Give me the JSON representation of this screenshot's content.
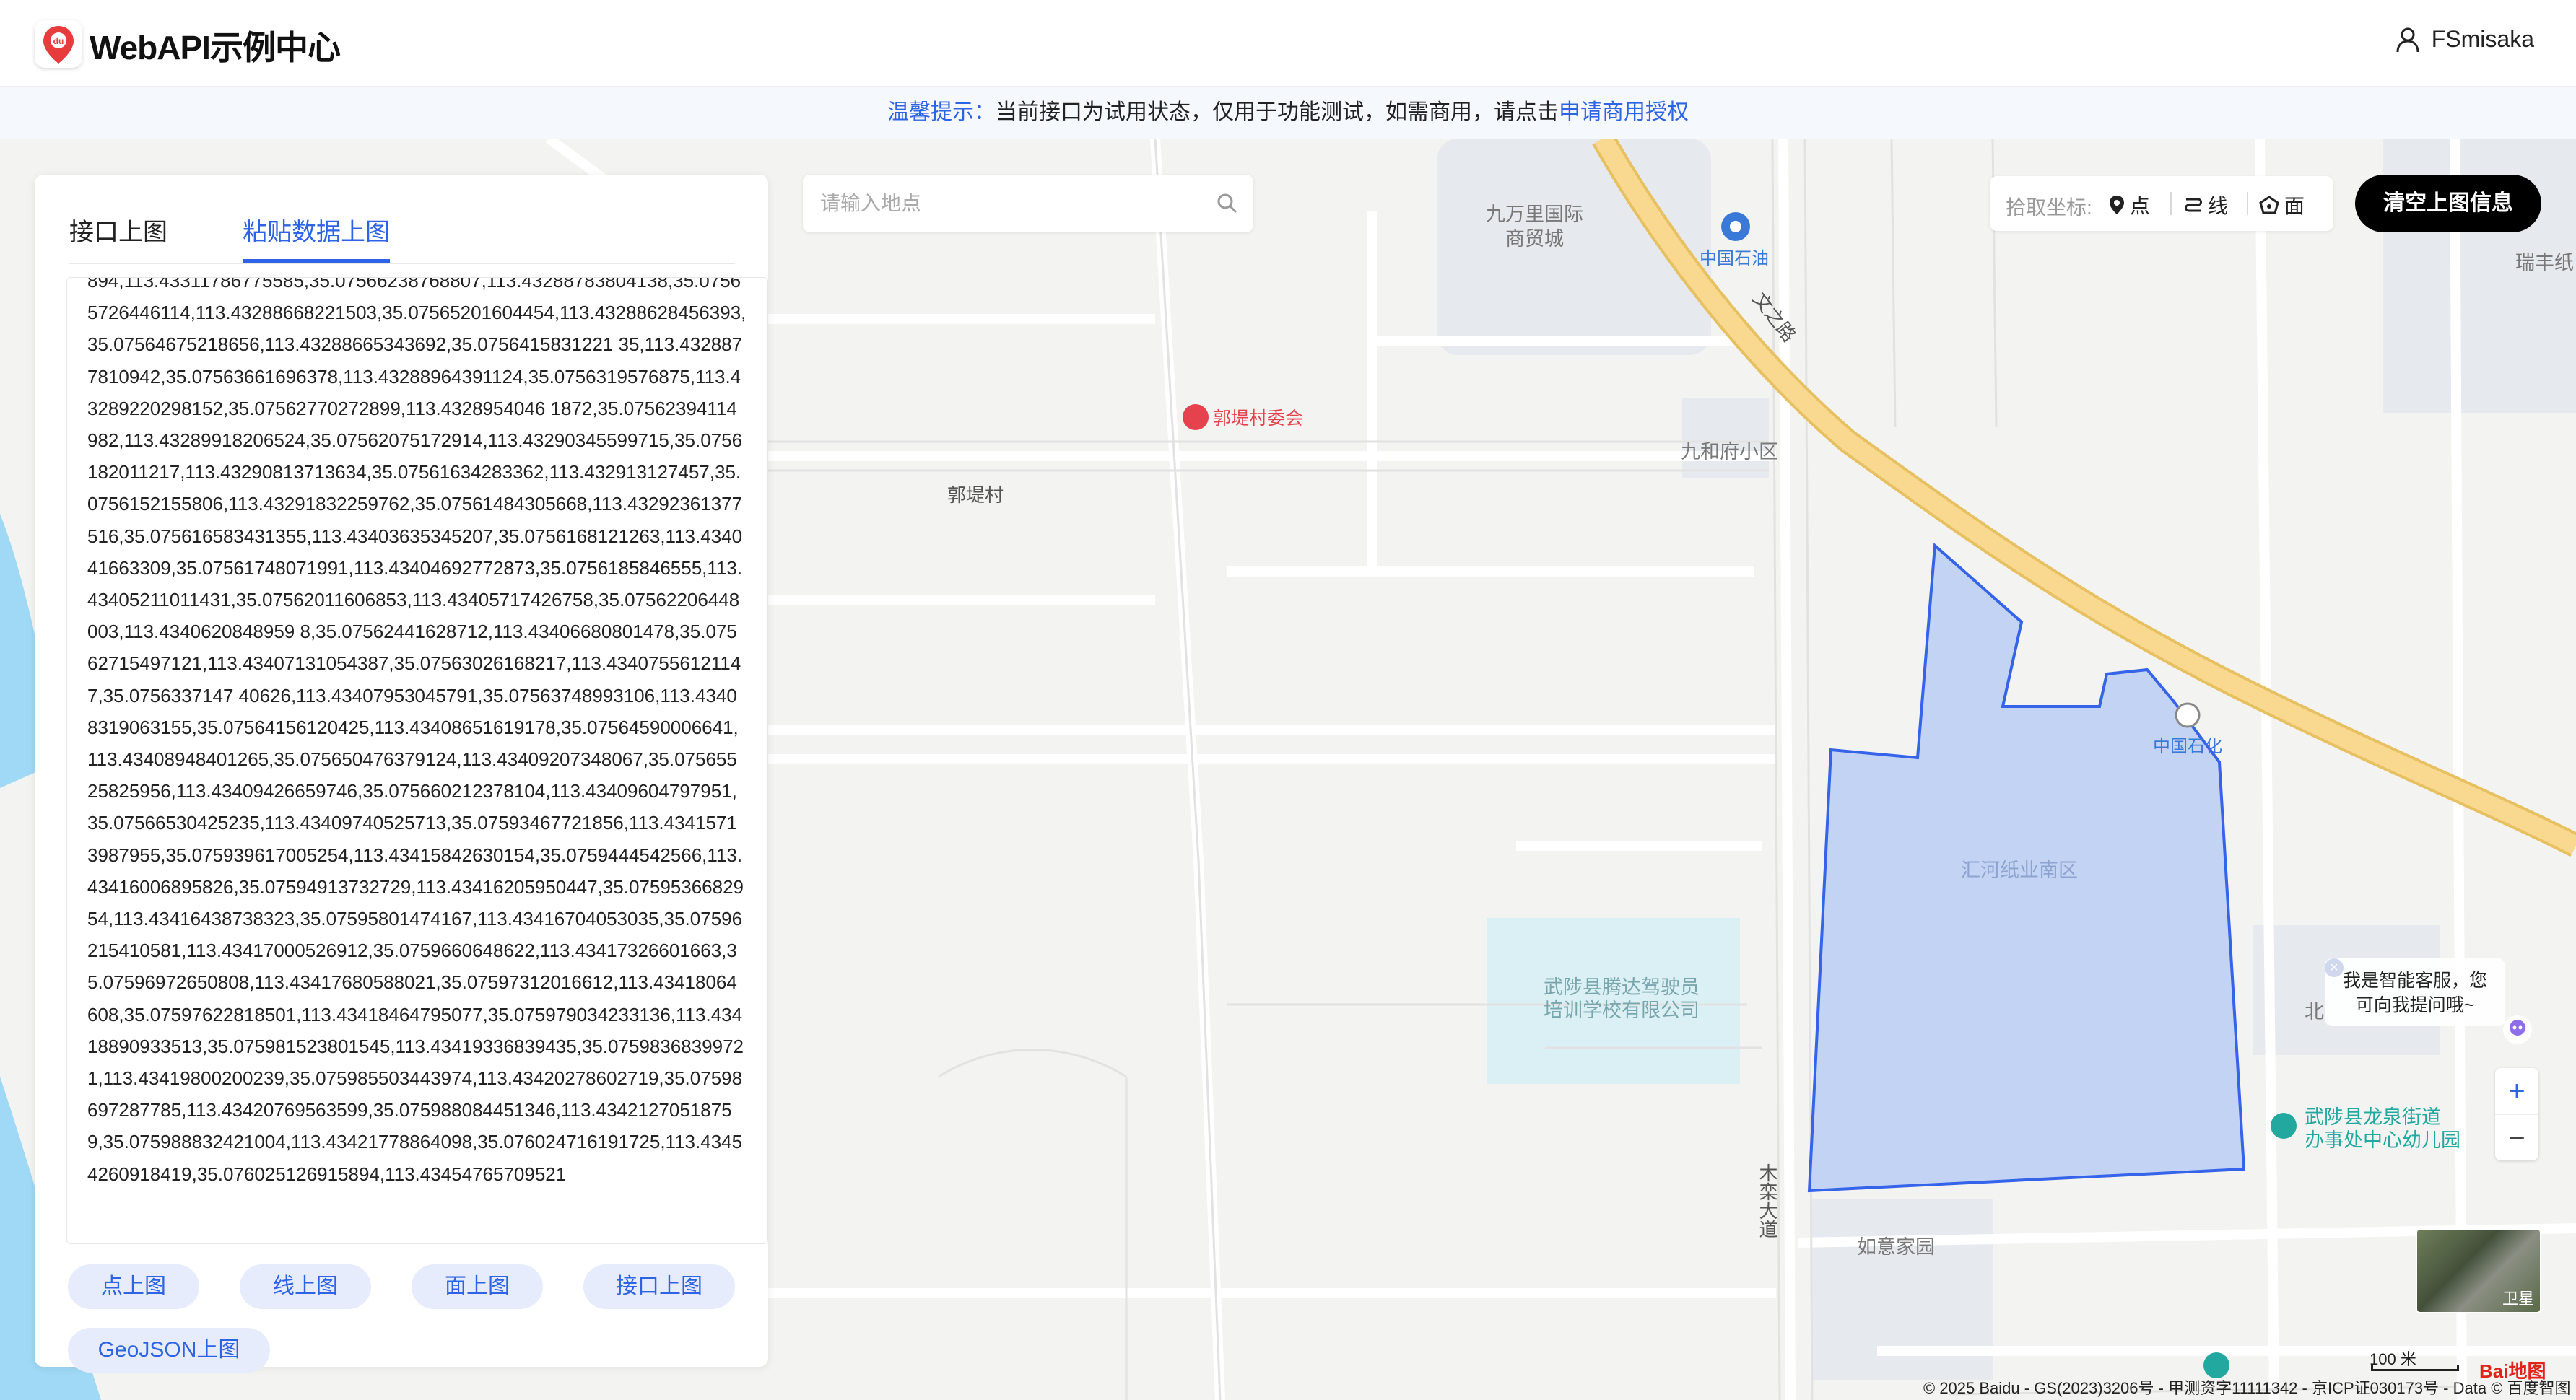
{
  "header": {
    "brand": "WebAPI示例中心",
    "logo_text": "du",
    "username": "FSmisaka"
  },
  "notice": {
    "label": "温馨提示：",
    "text": "当前接口为试用状态，仅用于功能测试，如需商用，请点击",
    "link": "申请商用授权"
  },
  "panel": {
    "tabs": [
      {
        "label": "接口上图",
        "active": false
      },
      {
        "label": "粘贴数据上图",
        "active": true
      }
    ],
    "textarea_value": "894,113.43311786775585,35.07566238768807,113.43288783804138,35.07565726446114,113.43288668221503,35.07565201604454,113.43288628456393,35.07564675218656,113.43288665343692,35.0756415831221 35,113.4328877810942,35.07563661696378,113.43288964391124,35.0756319576875,113.43289220298152,35.07562770272899,113.4328954046 1872,35.07562394114982,113.43289918206524,35.07562075172914,113.43290345599715,35.0756182011217,113.43290813713634,35.07561634283362,113.432913127457,35.0756152155806,113.43291832259762,35.07561484305668,113.43292361377516,35.075616583431355,113.43403635345207,35.0756168121263,113.434041663309,35.07561748071991,113.43404692772873,35.0756185846555,113.43405211011431,35.07562011606853,113.43405717426758,35.07562206448003,113.4340620848959 8,35.07562441628712,113.43406680801478,35.07562715497121,113.43407131054387,35.07563026168217,113.43407556121147,35.0756337147 40626,113.43407953045791,35.07563748993106,113.43408319063155,35.07564156120425,113.43408651619178,35.07564590006641,113.43408948401265,35.075650476379124,113.43409207348067,35.07565525825956,113.43409426659746,35.075660212378104,113.43409604797951,35.07566530425235,113.43409740525713,35.07593467721856,113.43415713987955,35.075939617005254,113.43415842630154,35.0759444542566,113.43416006895826,35.07594913732729,113.43416205950447,35.0759536682954,113.43416438738323,35.07595801474167,113.43416704053035,35.07596215410581,113.43417000526912,35.0759660648622,113.43417326601663,35.07596972650808,113.43417680588021,35.07597312016612,113.43418064608,35.07597622818501,113.43418464795077,35.075979034233136,113.43418890933513,35.075981523801545,113.43419336839435,35.07598368399721,113.43419800200239,35.075985503443974,113.43420278602719,35.07598697287785,113.43420769563599,35.075988084451346,113.43421270518759,35.075988832421004,113.43421778864098,35.076024716191725,113.43454260918419,35.076025126915894,113.43454765709521",
    "buttons": [
      "点上图",
      "线上图",
      "面上图",
      "接口上图",
      "GeoJSON上图"
    ]
  },
  "search": {
    "placeholder": "请输入地点"
  },
  "pick": {
    "label": "拾取坐标:",
    "items": [
      {
        "label": "点",
        "icon": "pin-icon"
      },
      {
        "label": "线",
        "icon": "line-icon"
      },
      {
        "label": "面",
        "icon": "polygon-icon"
      }
    ]
  },
  "clear_button": "清空上图信息",
  "map": {
    "labels": {
      "jiuwanli": "九万里国际\n商贸城",
      "sinopec_oil": "中国石油",
      "wenzhi_road": "文之路",
      "ruifeng": "瑞丰纸",
      "guodi_committee": "郭堤村委会",
      "guodi_village": "郭堤村",
      "jiuhe": "九和府小区",
      "sinopec": "中国石化",
      "paper_park": "汇河纸业南区",
      "driving_school": "武陟县腾达驾驶员\n培训学校有限公司",
      "bei": "北",
      "kindergarten": "武陟县龙泉街道\n办事处中心幼儿园",
      "mulan_road": "木栾大道",
      "ruyi": "如意家园"
    },
    "polygon_fill": "#b8cdf5",
    "polygon_stroke": "#3563e9",
    "road_main": "#f6d27f",
    "water": "#9fd9f5"
  },
  "kefu": {
    "line1": "我是智能客服，您",
    "line2": "可向我提问哦~",
    "close": "×"
  },
  "zoom": {
    "plus": "+",
    "minus": "−"
  },
  "satellite_label": "卫星",
  "scale_label": "100 米",
  "copyright": "© 2025 Baidu - GS(2023)3206号 - 甲测资字11111342 - 京ICP证030173号 - Data © 百度智图",
  "baidu_logo": "Bai地图"
}
